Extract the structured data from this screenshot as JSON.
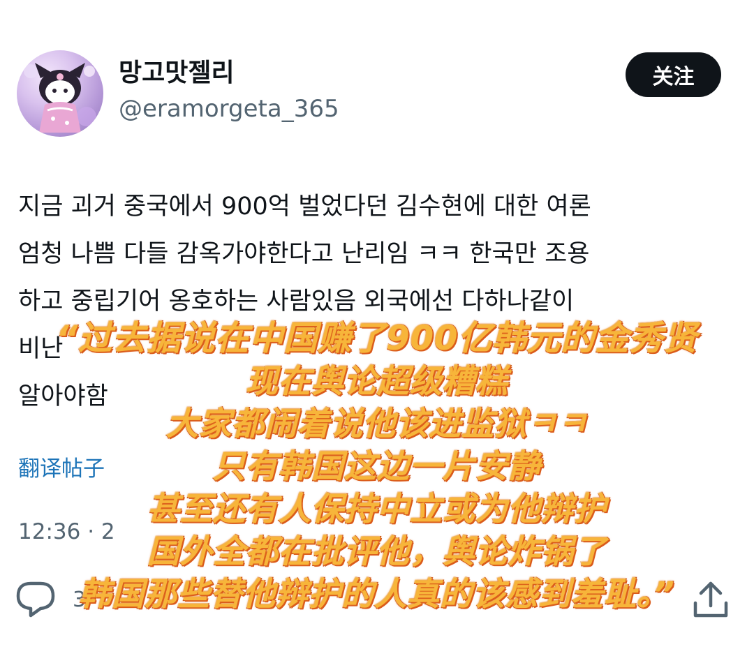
{
  "user": {
    "display_name": "망고맛젤리",
    "handle": "@eramorgeta_365"
  },
  "follow_label": "关注",
  "tweet": {
    "lines": [
      "지금 괴거 중국에서 900억 벌었다던 김수현에 대한 여론",
      "엄청 나쁨 다들 감옥가야한다고 난리임 ㅋㅋ 한국만 조용",
      "하고 중립기어 옹호하는 사람있음 외국에선 다하나같이",
      "비난",
      "알아야함"
    ]
  },
  "translate_label": "翻译帖子",
  "timestamp": "12:36 · 2",
  "actions": {
    "reply_count": "3"
  },
  "caption": {
    "lines": [
      "“过去据说在中国赚了900亿韩元的金秀贤",
      "现在舆论超级糟糕",
      "大家都闹着说他该进监狱ㅋㅋ",
      "只有韩国这边一片安静",
      "甚至还有人保持中立或为他辩护",
      "国外全都在批评他，舆论炸锅了",
      "韩国那些替他辩护的人真的该感到羞耻。”"
    ]
  },
  "colors": {
    "caption_fill": "#f7b53a",
    "caption_stroke": "#c8501a",
    "follow_bg": "#0f1419",
    "link": "#1d74b8",
    "secondary_text": "#536471"
  }
}
